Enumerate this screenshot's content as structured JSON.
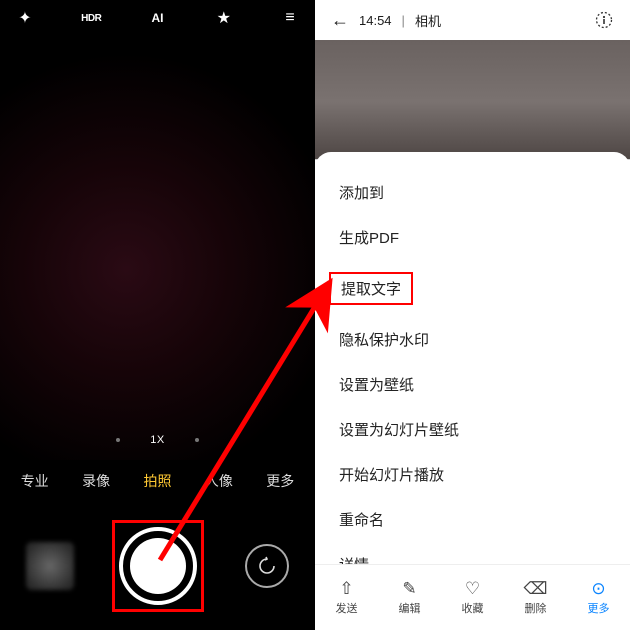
{
  "camera": {
    "topIcons": {
      "flash": "✦",
      "hdr": "HDR",
      "ai": "AI",
      "filter": "★",
      "menu": "≡"
    },
    "zoom": "1X",
    "modes": [
      "专业",
      "录像",
      "拍照",
      "人像",
      "更多"
    ],
    "activeMode": "拍照"
  },
  "gallery": {
    "time": "14:54",
    "source": "相机",
    "sheet": [
      "添加到",
      "生成PDF",
      "提取文字",
      "隐私保护水印",
      "设置为壁纸",
      "设置为幻灯片壁纸",
      "开始幻灯片播放",
      "重命名",
      "详情"
    ],
    "highlightIndex": 2,
    "bottom": [
      {
        "icon": "⇧",
        "label": "发送"
      },
      {
        "icon": "✎",
        "label": "编辑"
      },
      {
        "icon": "♡",
        "label": "收藏"
      },
      {
        "icon": "⌫",
        "label": "删除"
      },
      {
        "icon": "⊙",
        "label": "更多"
      }
    ],
    "activeBottom": 4
  }
}
